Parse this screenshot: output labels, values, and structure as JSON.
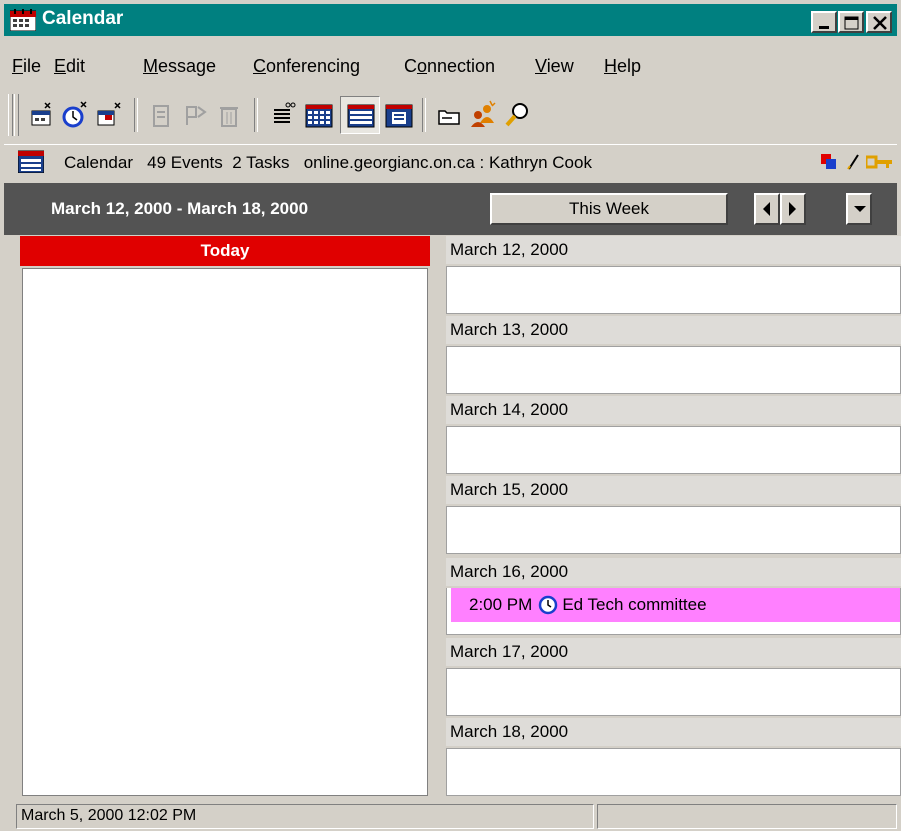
{
  "window": {
    "title": "Calendar",
    "colors": {
      "titlebar": "#008080",
      "today": "#e00000",
      "event": "#ff80ff",
      "navbar": "#535353"
    }
  },
  "menu": [
    "File",
    "Edit",
    "Message",
    "Conferencing",
    "Connection",
    "View",
    "Help"
  ],
  "menu_underline": [
    "F",
    "E",
    "M",
    "C",
    "o",
    "V",
    "H"
  ],
  "toolbar": {
    "icons": [
      "new-event-icon",
      "new-task-icon",
      "new-note-icon",
      "print-icon",
      "flag-icon",
      "delete-icon",
      "list-view-icon",
      "month-view-icon",
      "week-view-icon",
      "day-view-icon",
      "open-folder-icon",
      "who-is-online-icon",
      "find-icon"
    ]
  },
  "info": {
    "text": "Calendar   49 Events  2 Tasks   online.georgianc.on.ca : Kathryn Cook"
  },
  "nav": {
    "range": "March 12, 2000 - March 18, 2000",
    "this_week": "This Week"
  },
  "today": {
    "label": "Today"
  },
  "days": [
    {
      "date": "March 12, 2000"
    },
    {
      "date": "March 13, 2000"
    },
    {
      "date": "March 14, 2000"
    },
    {
      "date": "March 15, 2000"
    },
    {
      "date": "March 16, 2000"
    },
    {
      "date": "March 17, 2000"
    },
    {
      "date": "March 18, 2000"
    }
  ],
  "event": {
    "time": "2:00 PM",
    "title": "Ed Tech committee"
  },
  "status": {
    "text": "March 5, 2000 12:02 PM"
  }
}
